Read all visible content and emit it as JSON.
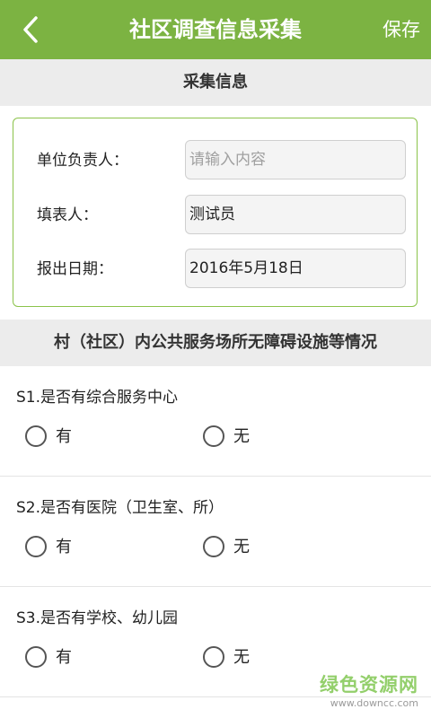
{
  "app_bar": {
    "back_icon": "chevron-left-icon",
    "title": "社区调查信息采集",
    "save_label": "保存",
    "color": "#7cb342"
  },
  "collect_section": {
    "header": "采集信息",
    "fields": [
      {
        "label": "单位负责人：",
        "value": "",
        "placeholder": "请输入内容"
      },
      {
        "label": "填表人：",
        "value": "测试员",
        "placeholder": ""
      },
      {
        "label": "报出日期：",
        "value": "2016年5月18日",
        "placeholder": ""
      }
    ]
  },
  "facility_section": {
    "header": "村（社区）内公共服务场所无障碍设施等情况",
    "questions": [
      {
        "text": "S1.是否有综合服务中心",
        "options": [
          "有",
          "无"
        ]
      },
      {
        "text": "S2.是否有医院（卫生室、所）",
        "options": [
          "有",
          "无"
        ]
      },
      {
        "text": "S3.是否有学校、幼儿园",
        "options": [
          "有",
          "无"
        ]
      }
    ]
  },
  "watermark": {
    "main": "绿色资源网",
    "sub": "www.downcc.com"
  }
}
